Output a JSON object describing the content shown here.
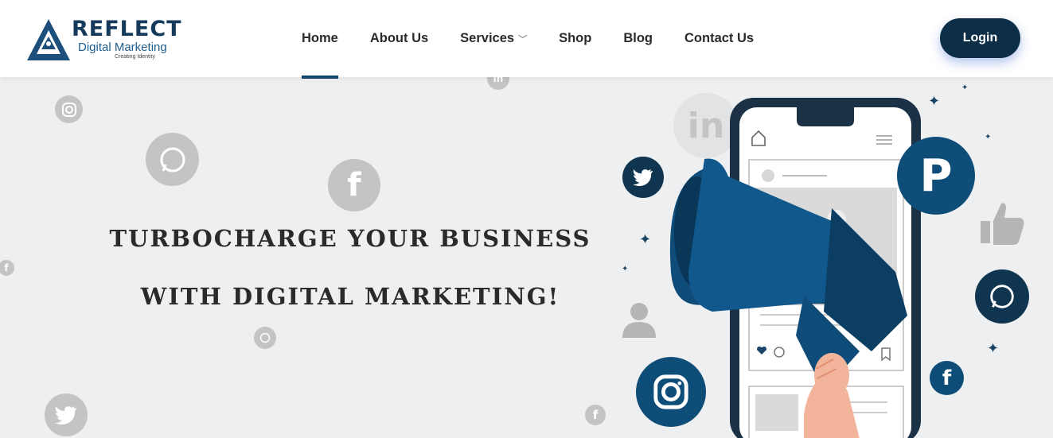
{
  "brand": {
    "name": "REFLECT",
    "subtitle": "Digital Marketing",
    "tagline": "Creating Identity",
    "color": "#153a5b"
  },
  "nav": {
    "items": [
      {
        "label": "Home",
        "active": true
      },
      {
        "label": "About Us"
      },
      {
        "label": "Services",
        "has_dropdown": true
      },
      {
        "label": "Shop"
      },
      {
        "label": "Blog"
      },
      {
        "label": "Contact Us"
      }
    ]
  },
  "login": {
    "label": "Login",
    "color": "#0d2e47"
  },
  "hero": {
    "line1": "TURBOCHARGE YOUR BUSINESS",
    "line2": "WITH DIGITAL MARKETING!"
  },
  "icons": {
    "linkedin": "in",
    "facebook": "f"
  }
}
